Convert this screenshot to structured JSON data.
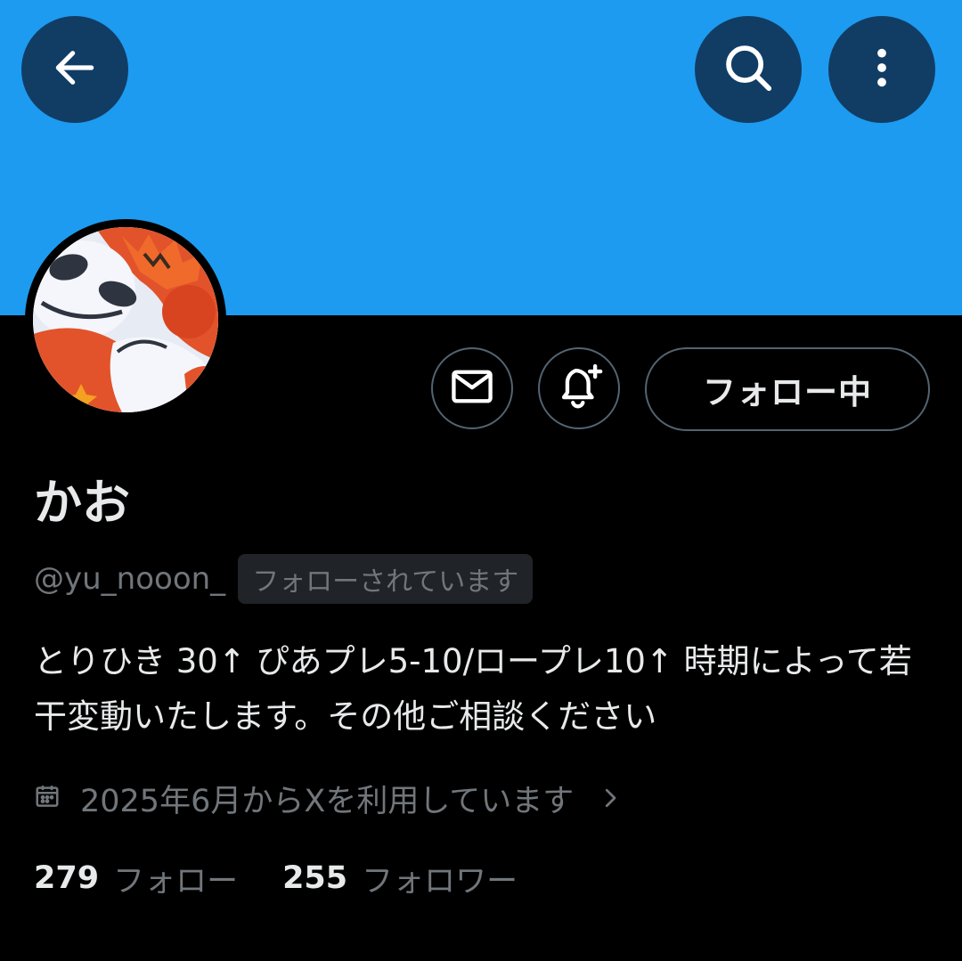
{
  "header": {
    "back_icon": "arrow-left-icon",
    "search_icon": "search-icon",
    "more_icon": "more-vertical-icon",
    "banner_color": "#1d9bf0"
  },
  "profile": {
    "display_name": "かお",
    "handle": "@yu_nooon_",
    "follows_you_badge": "フォローされています",
    "bio": "とりひき 30↑ ぴあプレ5-10/ロープレ10↑ 時期によって若干変動いたします。その他ご相談ください",
    "joined": "2025年6月からXを利用しています",
    "following_count": "279",
    "following_label": "フォロー",
    "followers_count": "255",
    "followers_label": "フォロワー"
  },
  "actions": {
    "message_icon": "mail-icon",
    "notify_icon": "bell-plus-icon",
    "follow_button_label": "フォロー中"
  },
  "colors": {
    "background": "#000000",
    "primary_text": "#e7e9ea",
    "secondary_text": "#71767b",
    "border": "#536471",
    "badge_bg": "#202327"
  }
}
